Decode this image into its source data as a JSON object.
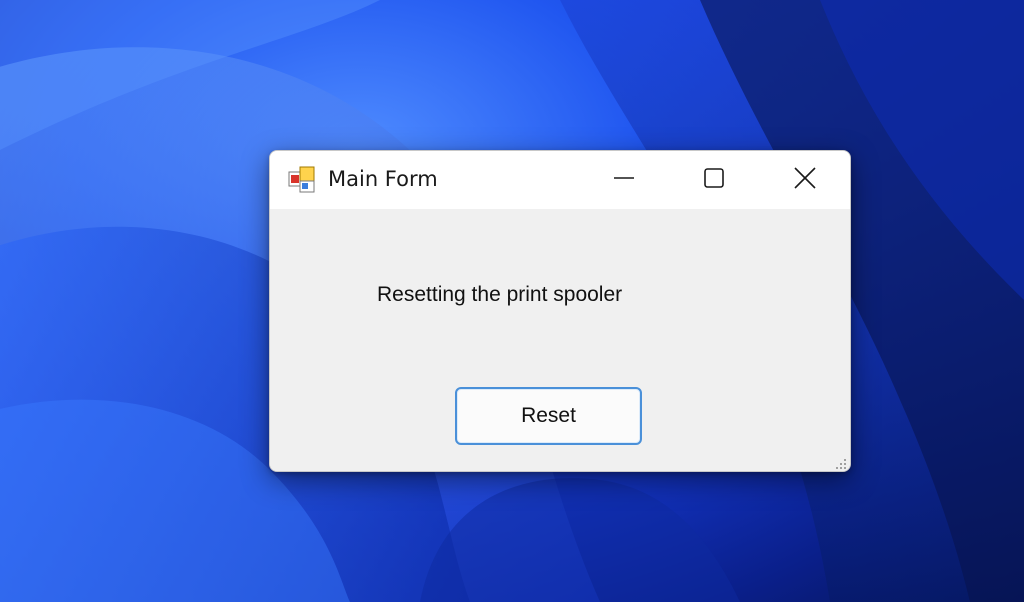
{
  "desktop": {
    "wallpaper": "Windows 11 bloom",
    "colors": [
      "#2157f0",
      "#0a1f8a",
      "#4f8cff"
    ]
  },
  "window": {
    "title": "Main Form",
    "app_icon": "winforms-app-icon",
    "controls": {
      "minimize_icon": "minimize-icon",
      "maximize_icon": "maximize-icon",
      "close_icon": "close-icon"
    },
    "label_text": "Resetting the print spooler",
    "button_label": "Reset",
    "accent_color": "#4a90d9"
  }
}
